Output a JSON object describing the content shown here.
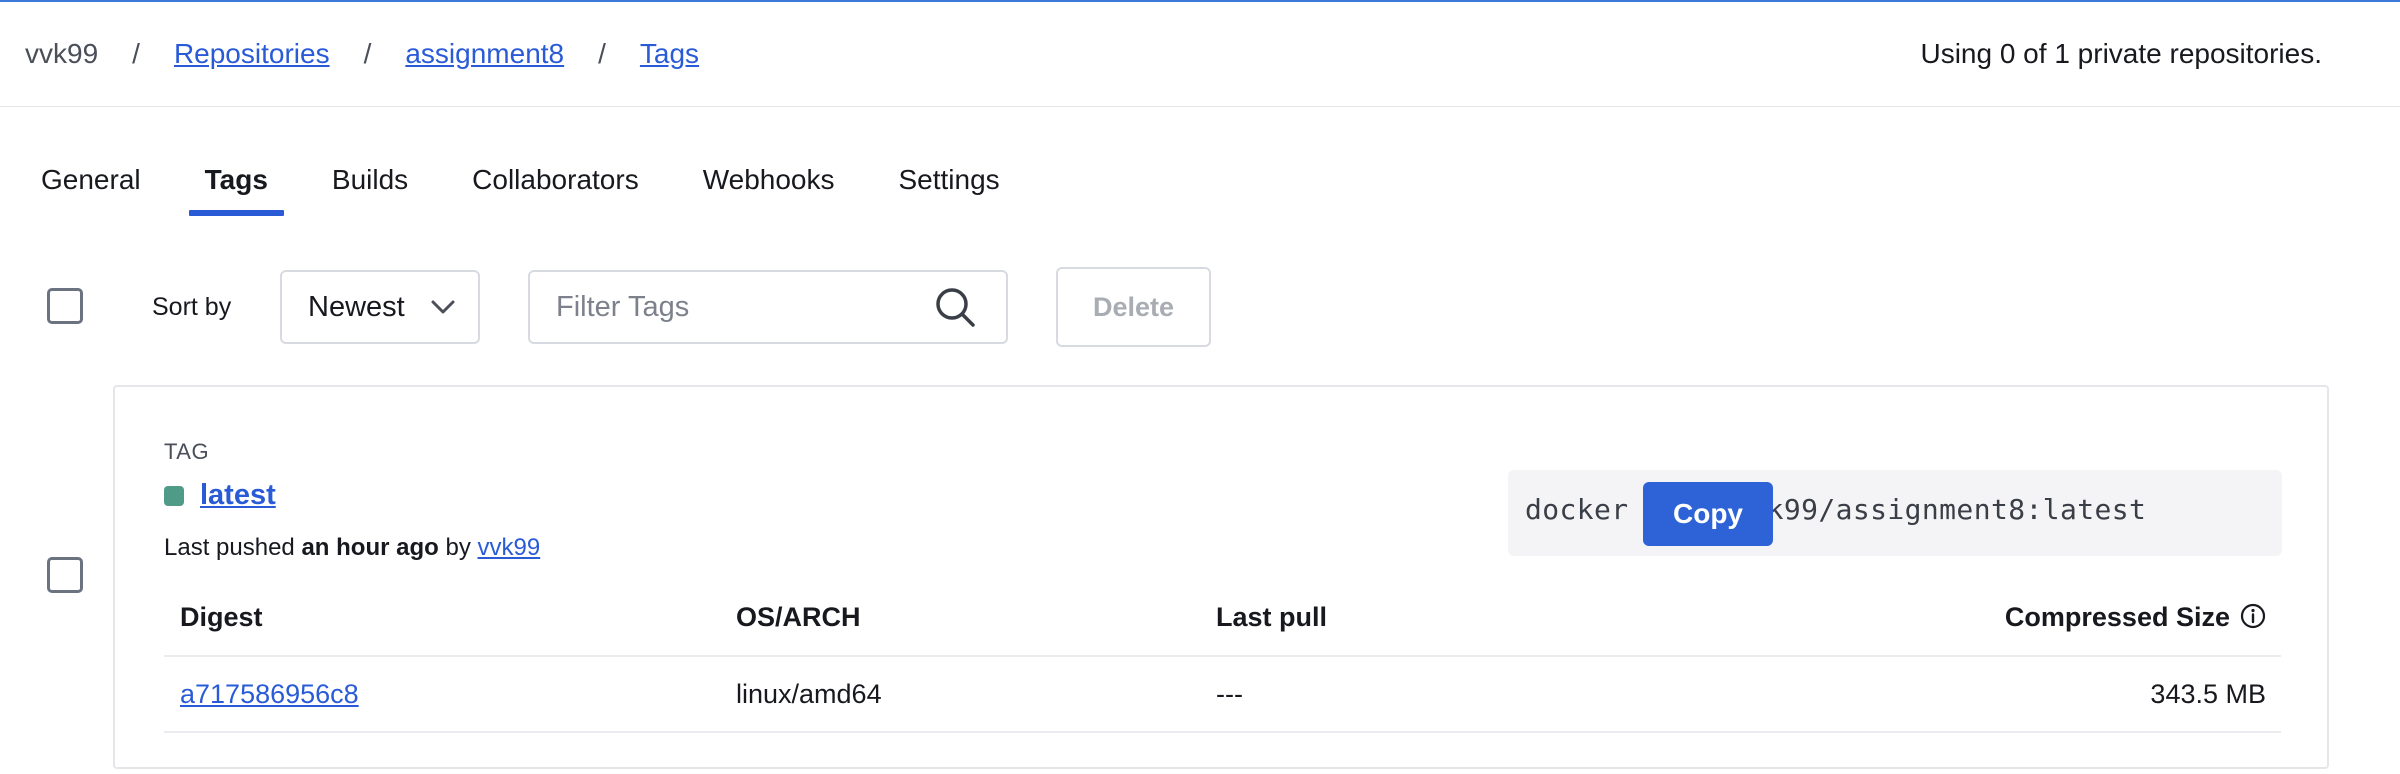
{
  "breadcrumb": {
    "user": "vvk99",
    "separator": "/",
    "repositories": "Repositories",
    "repo": "assignment8",
    "current": "Tags"
  },
  "usage": "Using 0 of 1 private repositories.",
  "tabs": [
    {
      "label": "General",
      "active": false
    },
    {
      "label": "Tags",
      "active": true
    },
    {
      "label": "Builds",
      "active": false
    },
    {
      "label": "Collaborators",
      "active": false
    },
    {
      "label": "Webhooks",
      "active": false
    },
    {
      "label": "Settings",
      "active": false
    }
  ],
  "toolbar": {
    "sort_label": "Sort by",
    "sort_value": "Newest",
    "filter_placeholder": "Filter Tags",
    "delete_label": "Delete"
  },
  "tag": {
    "heading": "TAG",
    "name": "latest",
    "pushed_prefix": "Last pushed",
    "pushed_time": "an hour ago",
    "pushed_by_word": "by",
    "pushed_by": "vvk99",
    "pull_command": "docker pull vvk99/assignment8:latest",
    "copy_label": "Copy"
  },
  "table": {
    "headers": {
      "digest": "Digest",
      "os_arch": "OS/ARCH",
      "last_pull": "Last pull",
      "size": "Compressed Size"
    },
    "rows": [
      {
        "digest": "a717586956c8",
        "os_arch": "linux/amd64",
        "last_pull": "---",
        "size": "343.5 MB"
      }
    ]
  },
  "colors": {
    "accent": "#2a5bd7",
    "status": "#4f9b87",
    "top_border": "#3c78d8"
  }
}
